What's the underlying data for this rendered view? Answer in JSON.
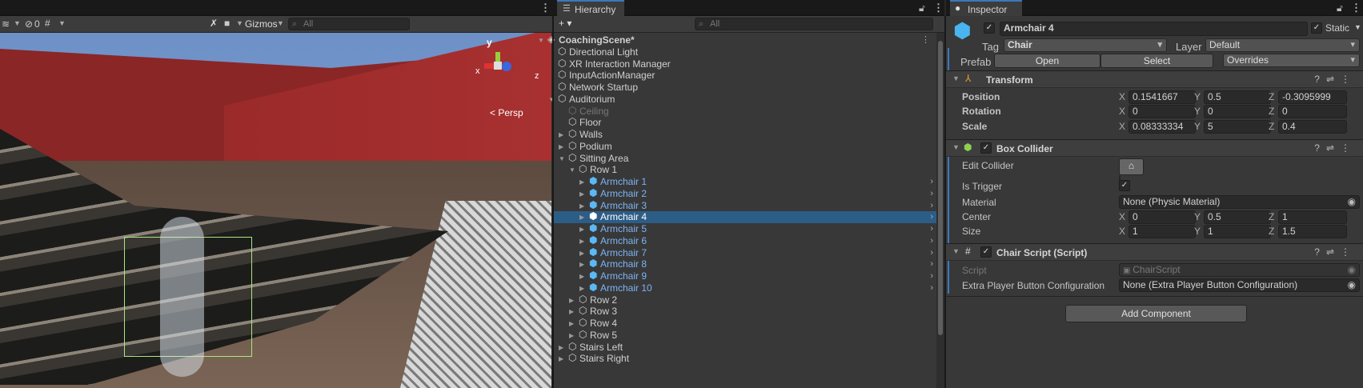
{
  "scene": {
    "toolbar": {
      "hidden_count": "0",
      "gizmos_label": "Gizmos",
      "search_placeholder": "All"
    },
    "gizmo": {
      "y_label": "y",
      "x_label": "x",
      "z_label": "z",
      "persp_label": "< Persp"
    }
  },
  "hierarchy": {
    "tab_label": "Hierarchy",
    "add_label": "+ ▾",
    "search_placeholder": "All",
    "items": [
      {
        "label": "CoachingScene*",
        "depth": 0,
        "arrow": "open",
        "type": "scene"
      },
      {
        "label": "Directional Light",
        "depth": 1,
        "arrow": "none",
        "type": "object"
      },
      {
        "label": "XR Interaction Manager",
        "depth": 1,
        "arrow": "none",
        "type": "object"
      },
      {
        "label": "InputActionManager",
        "depth": 1,
        "arrow": "none",
        "type": "object"
      },
      {
        "label": "Network Startup",
        "depth": 1,
        "arrow": "none",
        "type": "object"
      },
      {
        "label": "Auditorium",
        "depth": 1,
        "arrow": "open",
        "type": "object"
      },
      {
        "label": "Ceiling",
        "depth": 2,
        "arrow": "none",
        "type": "disabled"
      },
      {
        "label": "Floor",
        "depth": 2,
        "arrow": "none",
        "type": "object"
      },
      {
        "label": "Walls",
        "depth": 2,
        "arrow": "closed",
        "type": "object"
      },
      {
        "label": "Podium",
        "depth": 2,
        "arrow": "closed",
        "type": "object"
      },
      {
        "label": "Sitting Area",
        "depth": 2,
        "arrow": "open",
        "type": "object"
      },
      {
        "label": "Row 1",
        "depth": 3,
        "arrow": "open",
        "type": "object"
      },
      {
        "label": "Armchair 1",
        "depth": 4,
        "arrow": "closed",
        "type": "prefab"
      },
      {
        "label": "Armchair 2",
        "depth": 4,
        "arrow": "closed",
        "type": "prefab"
      },
      {
        "label": "Armchair 3",
        "depth": 4,
        "arrow": "closed",
        "type": "prefab"
      },
      {
        "label": "Armchair 4",
        "depth": 4,
        "arrow": "closed",
        "type": "prefab",
        "selected": true
      },
      {
        "label": "Armchair 5",
        "depth": 4,
        "arrow": "closed",
        "type": "prefab"
      },
      {
        "label": "Armchair 6",
        "depth": 4,
        "arrow": "closed",
        "type": "prefab"
      },
      {
        "label": "Armchair 7",
        "depth": 4,
        "arrow": "closed",
        "type": "prefab"
      },
      {
        "label": "Armchair 8",
        "depth": 4,
        "arrow": "closed",
        "type": "prefab"
      },
      {
        "label": "Armchair 9",
        "depth": 4,
        "arrow": "closed",
        "type": "prefab"
      },
      {
        "label": "Armchair 10",
        "depth": 4,
        "arrow": "closed",
        "type": "prefab"
      },
      {
        "label": "Row 2",
        "depth": 3,
        "arrow": "closed",
        "type": "object"
      },
      {
        "label": "Row 3",
        "depth": 3,
        "arrow": "closed",
        "type": "object"
      },
      {
        "label": "Row 4",
        "depth": 3,
        "arrow": "closed",
        "type": "object"
      },
      {
        "label": "Row 5",
        "depth": 3,
        "arrow": "closed",
        "type": "object"
      },
      {
        "label": "Stairs Left",
        "depth": 2,
        "arrow": "closed",
        "type": "object"
      },
      {
        "label": "Stairs Right",
        "depth": 2,
        "arrow": "closed",
        "type": "object"
      }
    ]
  },
  "inspector": {
    "tab_label": "Inspector",
    "name": "Armchair 4",
    "static_label": "Static",
    "tag_label": "Tag",
    "tag_value": "Chair",
    "layer_label": "Layer",
    "layer_value": "Default",
    "prefab_label": "Prefab",
    "open_label": "Open",
    "select_label": "Select",
    "overrides_label": "Overrides",
    "transform": {
      "title": "Transform",
      "position": {
        "label": "Position",
        "x": "0.1541667",
        "y": "0.5",
        "z": "-0.3095999"
      },
      "rotation": {
        "label": "Rotation",
        "x": "0",
        "y": "0",
        "z": "0"
      },
      "scale": {
        "label": "Scale",
        "x": "0.08333334",
        "y": "5",
        "z": "0.4"
      }
    },
    "box_collider": {
      "title": "Box Collider",
      "edit_label": "Edit Collider",
      "trigger_label": "Is Trigger",
      "material_label": "Material",
      "material_value": "None (Physic Material)",
      "center": {
        "label": "Center",
        "x": "0",
        "y": "0.5",
        "z": "1"
      },
      "size": {
        "label": "Size",
        "x": "1",
        "y": "1",
        "z": "1.5"
      }
    },
    "chair_script": {
      "title": "Chair Script (Script)",
      "script_label": "Script",
      "script_value": "ChairScript",
      "extra_label": "Extra Player Button Configuration",
      "extra_value": "None (Extra Player Button Configuration)"
    },
    "add_component_label": "Add Component",
    "axis": {
      "x": "X",
      "y": "Y",
      "z": "Z"
    },
    "colors": {
      "accent": "#3a79bb",
      "selection": "#2c5d87",
      "prefab_text": "#7cb4f5"
    }
  }
}
